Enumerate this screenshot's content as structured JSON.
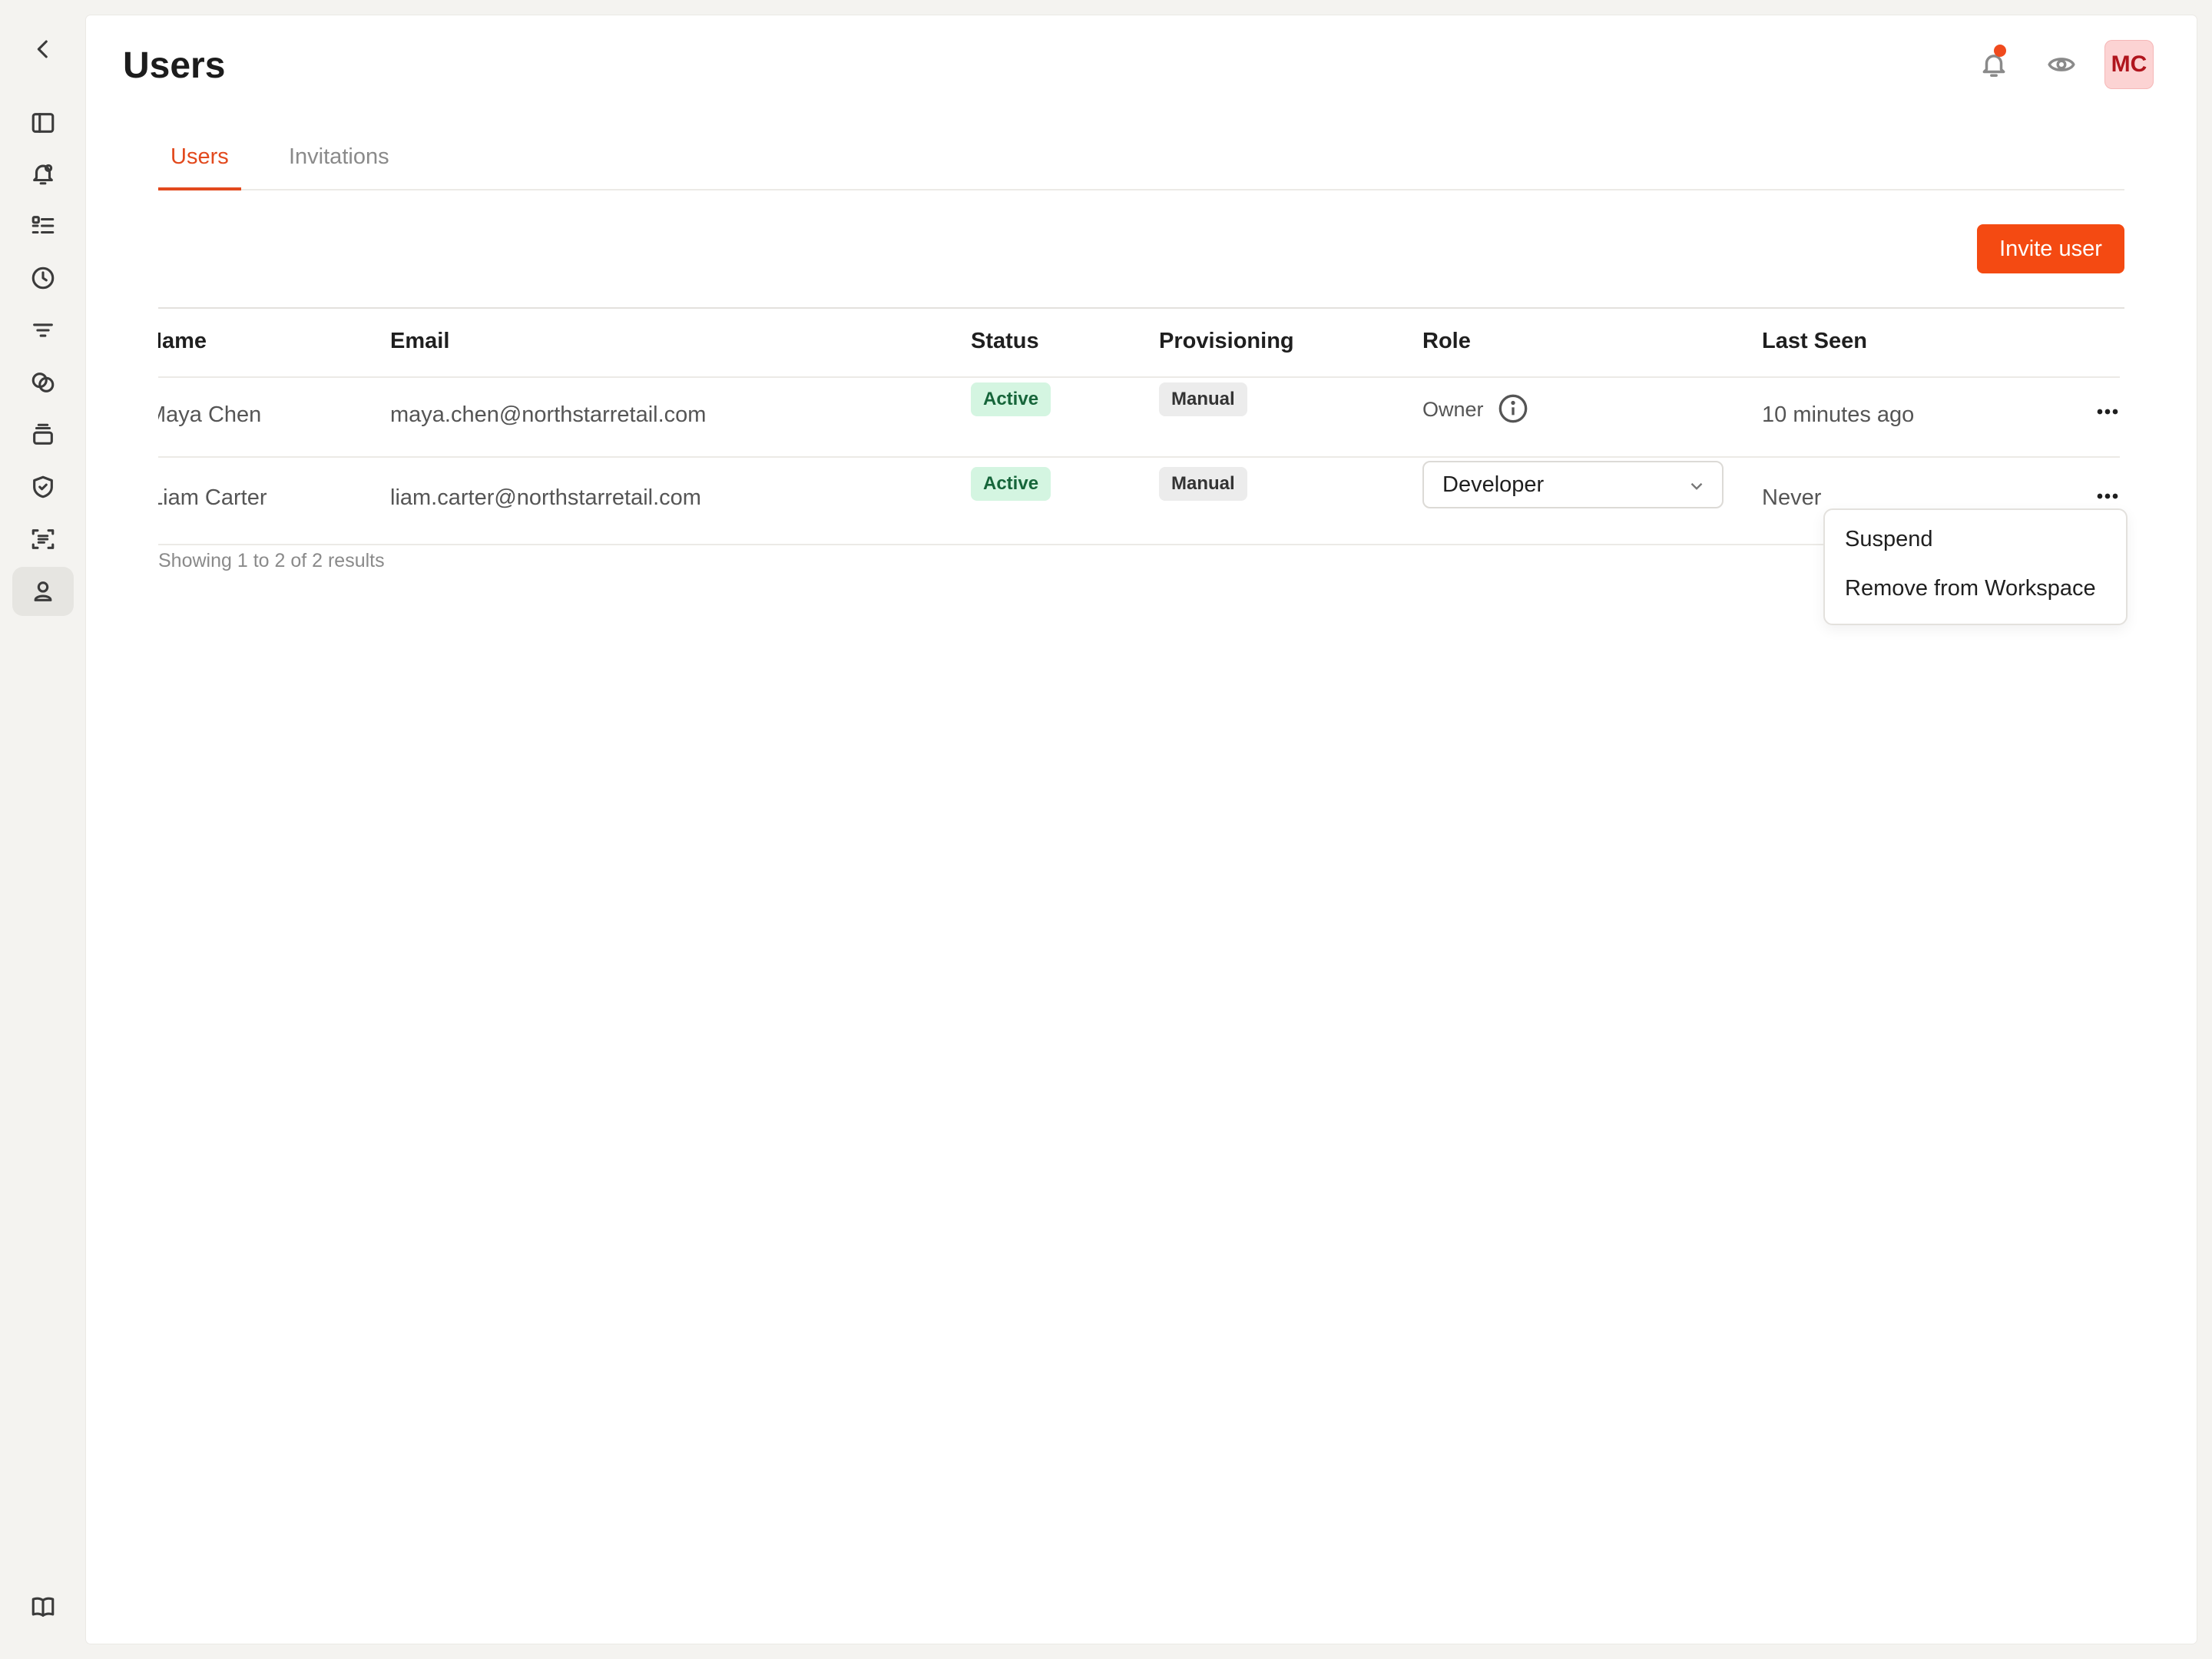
{
  "page": {
    "title": "Users"
  },
  "header": {
    "avatar_initials": "MC"
  },
  "tabs": [
    {
      "label": "Users",
      "active": true
    },
    {
      "label": "Invitations",
      "active": false
    }
  ],
  "toolbar": {
    "invite_label": "Invite user"
  },
  "table": {
    "columns": [
      "Name",
      "Email",
      "Status",
      "Provisioning",
      "Role",
      "Last Seen"
    ],
    "rows": [
      {
        "name": "Maya Chen",
        "email": "maya.chen@northstarretail.com",
        "status": "Active",
        "provisioning": "Manual",
        "role": "Owner",
        "last_seen": "10 minutes ago"
      },
      {
        "name": "Liam Carter",
        "email": "liam.carter@northstarretail.com",
        "status": "Active",
        "provisioning": "Manual",
        "role": "Developer",
        "last_seen": "Never"
      }
    ],
    "footer": "Showing 1 to 2 of 2 results"
  },
  "row_menu": {
    "items": [
      "Suspend",
      "Remove from Workspace"
    ]
  },
  "sidebar": {
    "icons": [
      "back-chevron-icon",
      "sidebar-toggle-icon",
      "alerts-icon",
      "checklist-icon",
      "history-icon",
      "filter-icon",
      "integrations-icon",
      "layers-icon",
      "shield-icon",
      "scan-text-icon",
      "user-icon",
      "book-icon"
    ]
  },
  "colors": {
    "accent": "#f44a12",
    "active_badge_bg": "#d4f5e1",
    "active_badge_text": "#16653a"
  }
}
